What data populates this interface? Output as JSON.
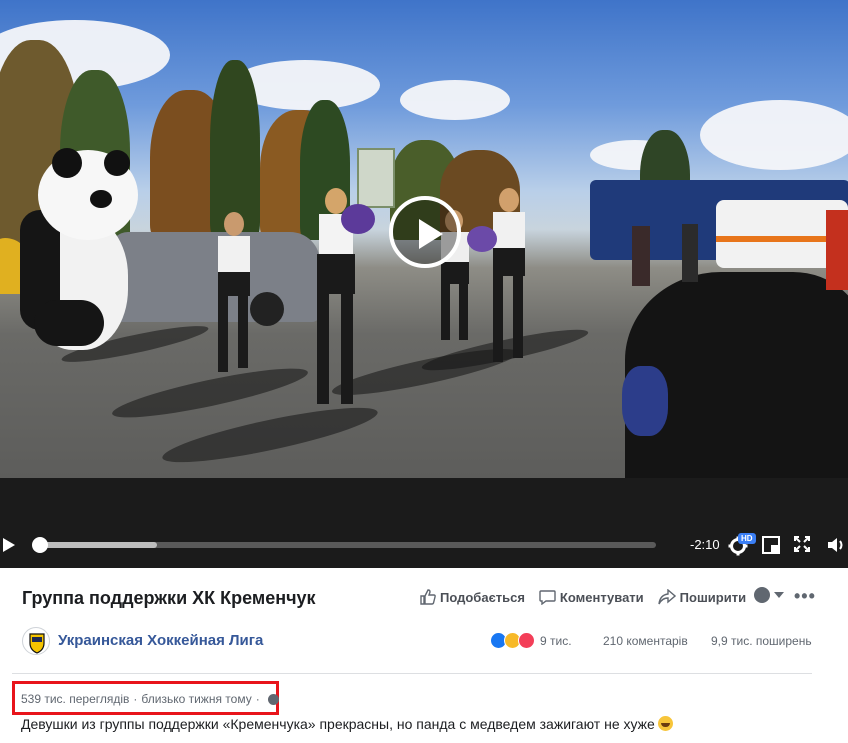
{
  "video": {
    "time_remaining": "-2:10",
    "quality_badge": "HD",
    "progress": 0.19,
    "played_fraction": 0.0
  },
  "post": {
    "title": "Группа поддержки ХК Кременчук",
    "actions": {
      "like": "Подобається",
      "comment": "Коментувати",
      "share": "Поширити"
    },
    "page_name": "Украинская Хоккейная Лига",
    "reactions_count": "9 тис.",
    "comments_count": "210 коментарів",
    "shares_count": "9,9 тис. поширень",
    "views": "539 тис. переглядів",
    "posted": "близько тижня тому",
    "separator": "·",
    "description": "Девушки из группы поддержки «Кременчука» прекрасны, но панда с медведем зажигают не хуже"
  },
  "icons": {
    "play": "play-icon",
    "settings": "gear-icon",
    "pip": "picture-in-picture-icon",
    "fullscreen": "fullscreen-icon",
    "volume": "volume-icon",
    "like": "thumbs-up-icon",
    "comment": "comment-bubble-icon",
    "share": "share-arrow-icon",
    "privacy": "globe-icon",
    "more": "ellipsis-icon"
  },
  "colors": {
    "link": "#365899",
    "highlight_box": "#e8141b",
    "hd_badge": "#3b7ff5"
  }
}
